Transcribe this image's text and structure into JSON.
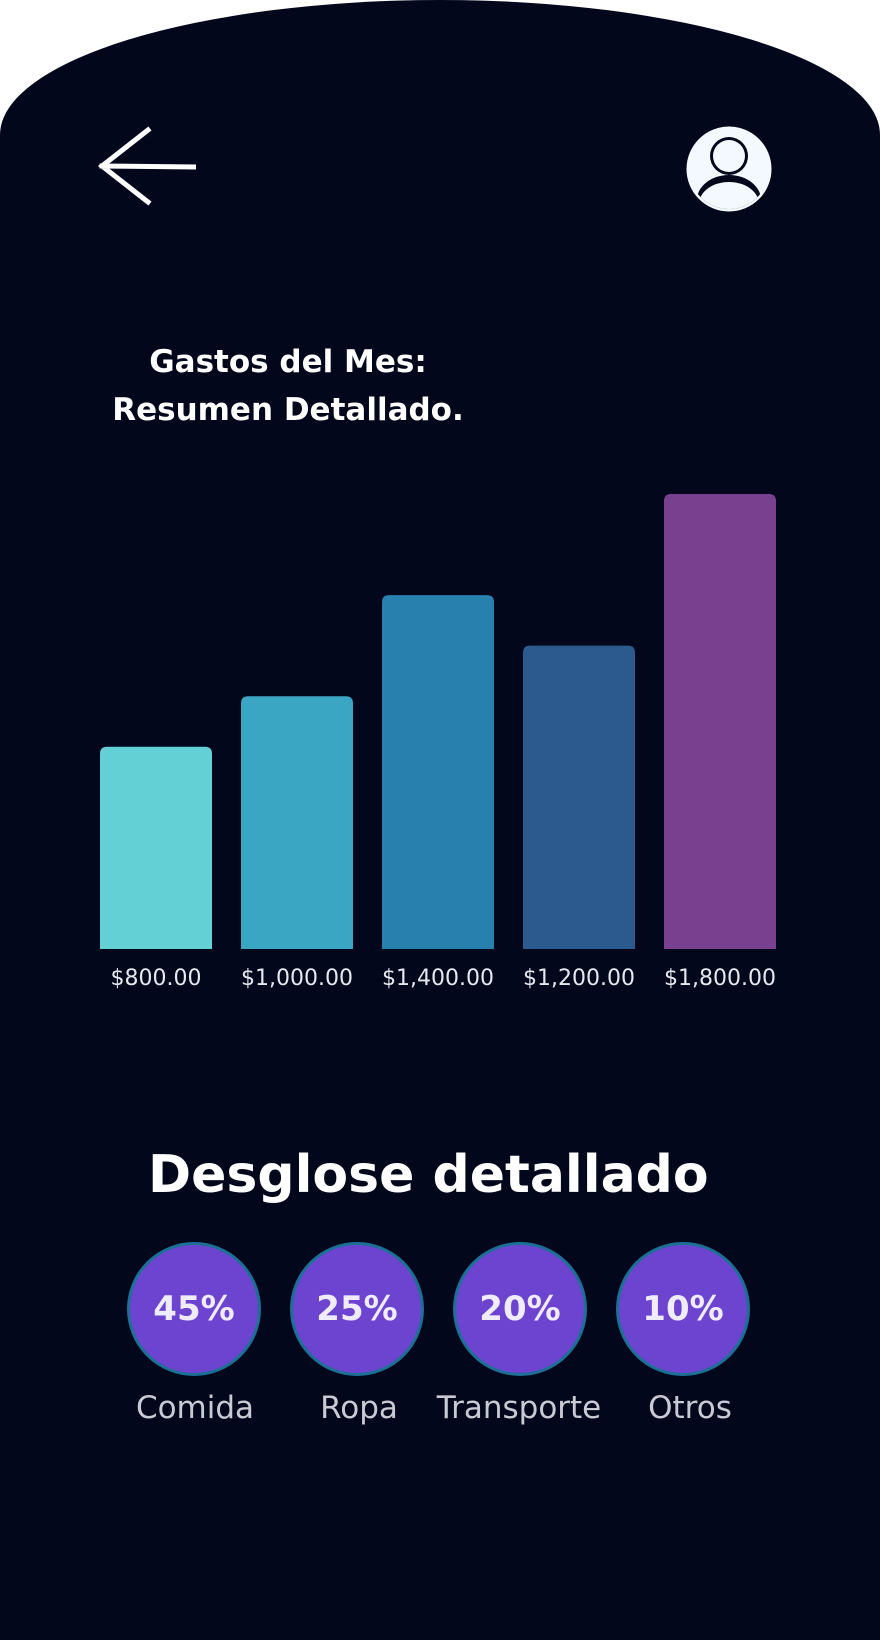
{
  "header": {
    "back_icon": "arrow-left-icon",
    "profile_icon": "user-avatar-icon"
  },
  "title": {
    "line1": "Gastos del Mes:",
    "line2": "Resumen Detallado."
  },
  "chart_data": {
    "type": "bar",
    "categories": [
      "$800.00",
      "$1,000.00",
      "$1,400.00",
      "$1,200.00",
      "$1,800.00"
    ],
    "values": [
      800,
      1000,
      1400,
      1200,
      1800
    ],
    "colors": [
      "#63d0d6",
      "#3ba5c4",
      "#2880ae",
      "#2c5a8e",
      "#79408f"
    ],
    "title": "",
    "xlabel": "",
    "ylabel": "",
    "ylim": [
      0,
      1800
    ],
    "grid": false,
    "legend": "none"
  },
  "breakdown": {
    "title": "Desglose detallado",
    "items": [
      {
        "percent": "45%",
        "label": "Comida"
      },
      {
        "percent": "25%",
        "label": "Ropa"
      },
      {
        "percent": "20%",
        "label": "Transporte"
      },
      {
        "percent": "10%",
        "label": "Otros"
      }
    ],
    "circle_color": "#6c44cf",
    "circle_border": "#1c6f95"
  }
}
